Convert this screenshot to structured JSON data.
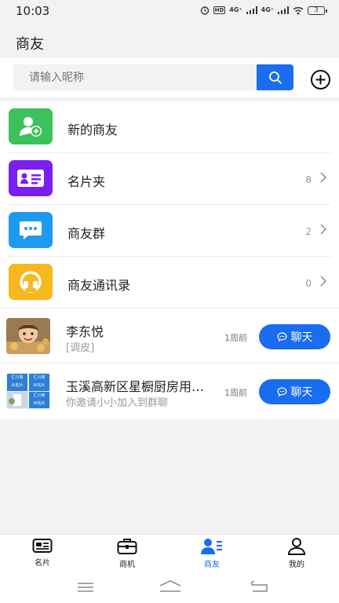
{
  "status": {
    "time": "10:03",
    "signal1": "4G⁺",
    "signal2": "4G⁺",
    "battery": "3",
    "hd": "HD"
  },
  "header": {
    "title": "商友"
  },
  "search": {
    "placeholder": "请输入昵称"
  },
  "menu": [
    {
      "label": "新的商友",
      "count": "",
      "icon": "add-user-icon",
      "color": "#3cc25a"
    },
    {
      "label": "名片夹",
      "count": "8",
      "icon": "business-card-icon",
      "color": "#7a1ff0"
    },
    {
      "label": "商友群",
      "count": "2",
      "icon": "chat-bubble-icon",
      "color": "#1e9bf0"
    },
    {
      "label": "商友通讯录",
      "count": "0",
      "icon": "headset-icon",
      "color": "#f7b71e"
    }
  ],
  "contacts": [
    {
      "name": "李东悦",
      "subtitle": "[调皮]",
      "time": "1周前",
      "button": "聊天"
    },
    {
      "name": "玉溪高新区星橱厨房用…",
      "subtitle": "你邀请小小加入到群聊",
      "time": "1周前",
      "button": "聊天"
    }
  ],
  "group_avatar_texts": [
    "汇川商",
    "AI名片"
  ],
  "tabs": [
    {
      "label": "名片",
      "icon": "card-icon"
    },
    {
      "label": "商机",
      "icon": "briefcase-icon"
    },
    {
      "label": "商友",
      "icon": "contacts-icon"
    },
    {
      "label": "我的",
      "icon": "user-icon"
    }
  ],
  "colors": {
    "accent": "#1a6cf0"
  }
}
